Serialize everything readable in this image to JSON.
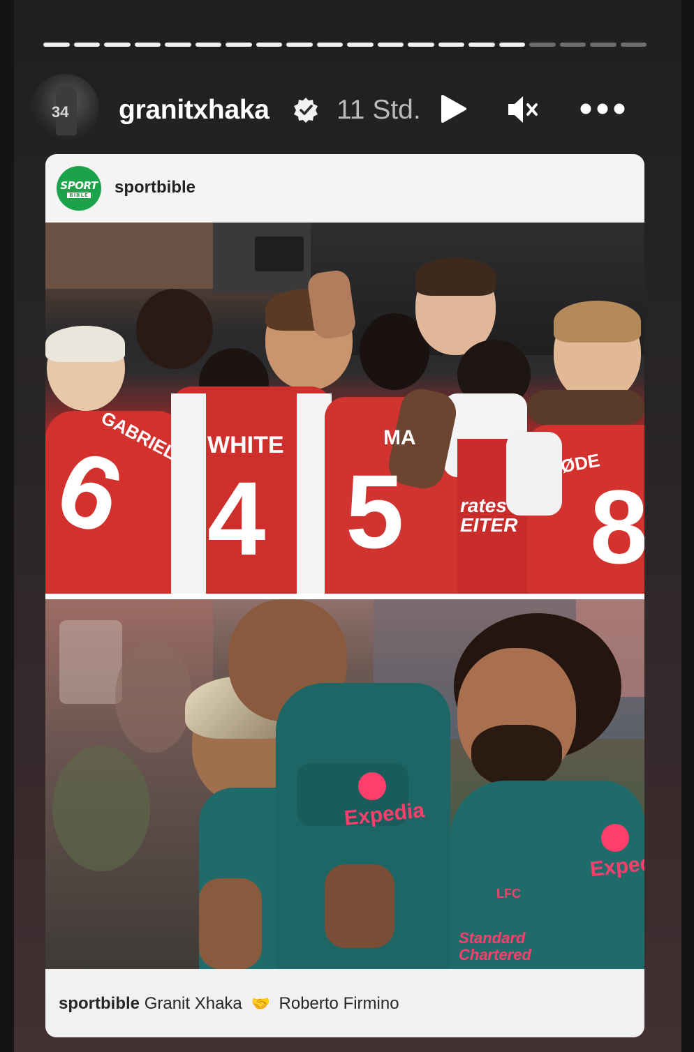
{
  "story": {
    "progress": {
      "total_segments": 20,
      "completed_segments": 16
    },
    "author": {
      "username": "granitxhaka",
      "verified": true,
      "time_ago": "11 Std.",
      "avatar_number": "34"
    },
    "controls": {
      "play_icon": "play-icon",
      "mute_icon": "speaker-muted-icon",
      "more_icon": "more-horizontal-icon"
    }
  },
  "shared_post": {
    "source": {
      "name": "sportbible",
      "logo_line1": "SPORT",
      "logo_line2": "BIBLE"
    },
    "photo_top": {
      "jerseys": [
        {
          "name": "GABRIEL",
          "number": "6"
        },
        {
          "name": "WHITE",
          "number": "4"
        },
        {
          "name": "MA",
          "number": "5"
        },
        {
          "name": "ØDE",
          "number": "8"
        }
      ],
      "sponsor_fragment": "rates\nEITER"
    },
    "photo_bottom": {
      "sponsor": "Expedia",
      "sponsor_fragment": "Expedi",
      "sleeve_sponsor": "Standard\nChartered",
      "crest_text": "LFC"
    },
    "caption": {
      "user": "sportbible",
      "text_before": "Granit Xhaka",
      "emoji": "🤝",
      "text_after": "Roberto Firmino"
    }
  },
  "colors": {
    "accent_brand_green": "#1aa34a",
    "arsenal_red": "#d3312d",
    "liverpool_teal": "#1f6b6a",
    "sponsor_pink": "#ff3e6c"
  }
}
